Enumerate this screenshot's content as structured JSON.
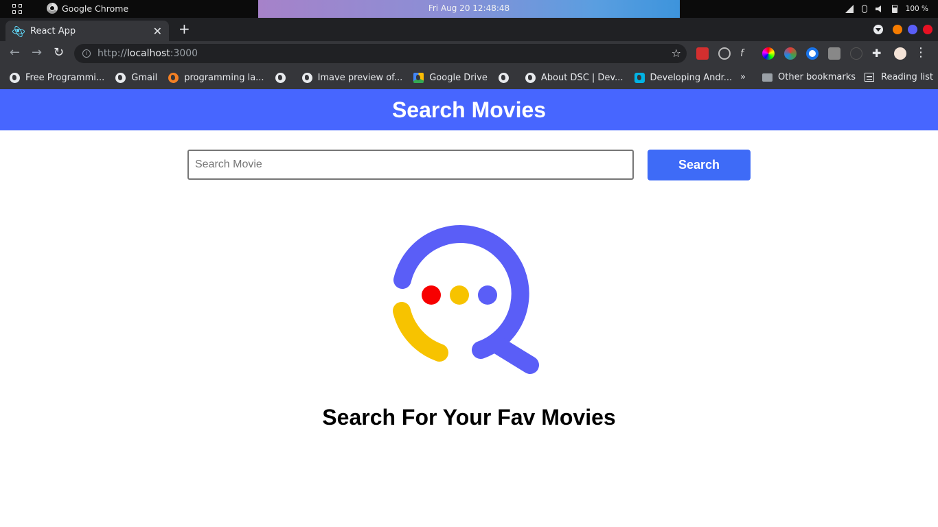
{
  "os": {
    "app_name": "Google Chrome",
    "datetime": "Fri Aug 20  12:48:48",
    "battery": "100 %"
  },
  "browser": {
    "tab_title": "React App",
    "url_scheme": "http://",
    "url_host": "localhost",
    "url_port": ":3000",
    "bookmarks": [
      {
        "label": "Free Programmi...",
        "icon": "freecodecamp-icon"
      },
      {
        "label": "Gmail",
        "icon": "globe-icon"
      },
      {
        "label": "programming la...",
        "icon": "stackoverflow-icon"
      },
      {
        "label": "",
        "icon": "globe-icon"
      },
      {
        "label": "Imave preview of...",
        "icon": "globe-icon"
      },
      {
        "label": "Google Drive",
        "icon": "drive-icon"
      },
      {
        "label": "",
        "icon": "globe-icon"
      },
      {
        "label": "About DSC | Dev...",
        "icon": "globe-icon"
      },
      {
        "label": "Developing Andr...",
        "icon": "udacity-icon"
      }
    ],
    "other_bookmarks": "Other bookmarks",
    "reading_list": "Reading list"
  },
  "page": {
    "header_title": "Search Movies",
    "search_placeholder": "Search Movie",
    "search_value": "",
    "search_button": "Search",
    "tagline": "Search For Your Fav Movies"
  },
  "colors": {
    "header_bg": "#4766ff",
    "button_bg": "#3e6bf7",
    "logo_blue": "#5a5ef7",
    "logo_yellow": "#f7c300",
    "logo_red": "#f70000"
  }
}
